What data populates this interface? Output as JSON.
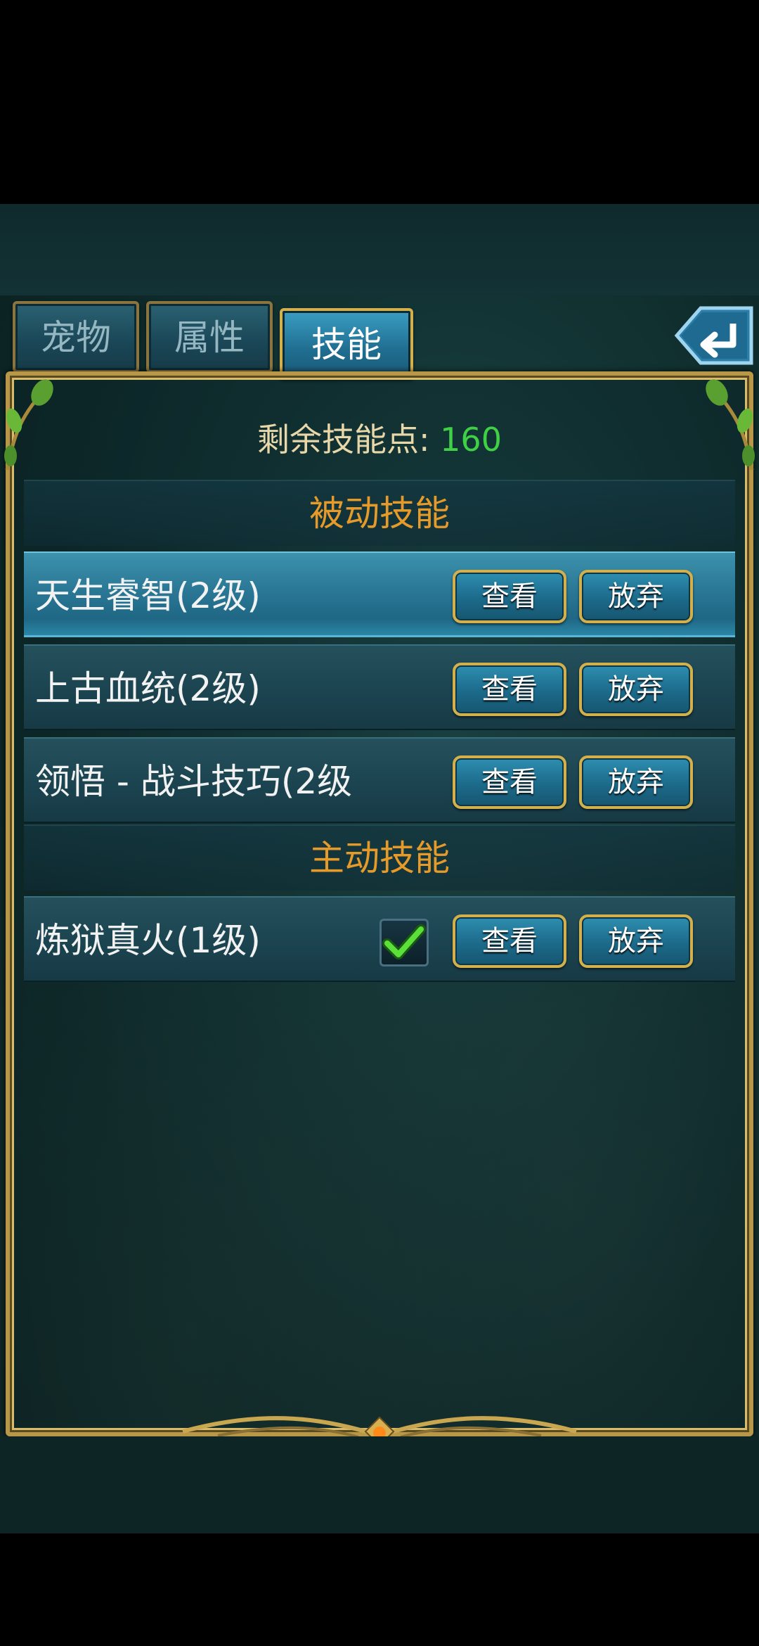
{
  "tabs": [
    {
      "label": "宠物",
      "active": false
    },
    {
      "label": "属性",
      "active": false
    },
    {
      "label": "技能",
      "active": true
    }
  ],
  "points": {
    "label": "剩余技能点:",
    "value": "160"
  },
  "sections": {
    "passive": "被动技能",
    "active": "主动技能"
  },
  "passive_skills": [
    {
      "name": "天生睿智(2级)",
      "selected": true
    },
    {
      "name": "上古血统(2级)",
      "selected": false
    },
    {
      "name": "领悟 - 战斗技巧(2级",
      "selected": false
    }
  ],
  "active_skills": [
    {
      "name": "炼狱真火(1级)",
      "checked": true
    }
  ],
  "buttons": {
    "view": "查看",
    "give_up": "放弃"
  },
  "colors": {
    "accent_gold": "#d2b04e",
    "points_green": "#3fd046",
    "section_orange": "#e69a2a"
  }
}
